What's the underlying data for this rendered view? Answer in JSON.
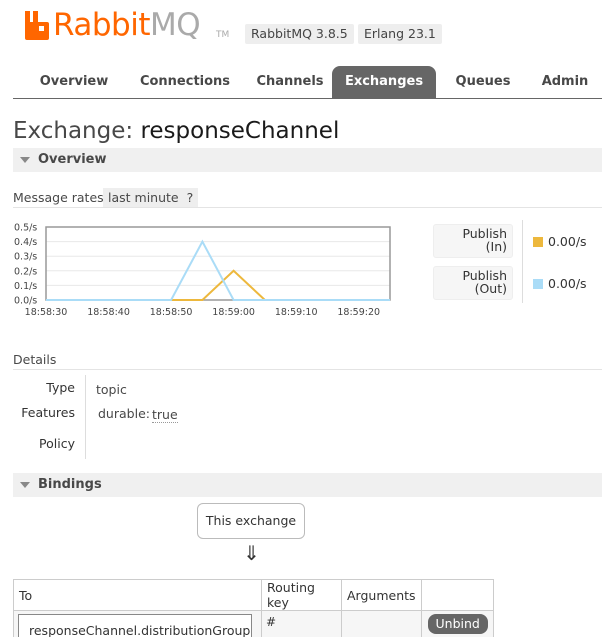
{
  "header": {
    "logo_text_rabbit": "Rabbit",
    "logo_text_mq": "MQ",
    "logo_tm": "TM",
    "logo_icon": "rabbitmq-logo-icon",
    "version_rabbitmq": "RabbitMQ 3.8.5",
    "version_erlang": "Erlang 23.1",
    "brand_color": "#ff6600"
  },
  "tabs": [
    {
      "label": "Overview"
    },
    {
      "label": "Connections"
    },
    {
      "label": "Channels"
    },
    {
      "label": "Exchanges",
      "active": true
    },
    {
      "label": "Queues"
    },
    {
      "label": "Admin"
    }
  ],
  "page": {
    "title_prefix": "Exchange:",
    "exchange_name": "responseChannel"
  },
  "overview": {
    "section_label": "Overview",
    "rates_label": "Message rates",
    "rates_period": "last minute",
    "rates_help": "?",
    "legend": [
      {
        "label_line1": "Publish",
        "label_line2": "(In)",
        "value": "0.00/s",
        "color": "#edb83d"
      },
      {
        "label_line1": "Publish",
        "label_line2": "(Out)",
        "value": "0.00/s",
        "color": "#aadcf7"
      }
    ]
  },
  "chart_data": {
    "type": "line",
    "x": [
      "18:58:30",
      "18:58:35",
      "18:58:40",
      "18:58:45",
      "18:58:50",
      "18:58:55",
      "18:59:00",
      "18:59:05",
      "18:59:10",
      "18:59:15",
      "18:59:20",
      "18:59:25"
    ],
    "x_tick_labels": [
      "18:58:30",
      "18:58:40",
      "18:58:50",
      "18:59:00",
      "18:59:10",
      "18:59:20"
    ],
    "series": [
      {
        "name": "Publish (In)",
        "color": "#edb83d",
        "values": [
          0,
          0,
          0,
          0,
          0,
          0,
          0.2,
          0,
          0,
          0,
          0,
          0
        ]
      },
      {
        "name": "Publish (Out)",
        "color": "#aadcf7",
        "values": [
          0,
          0,
          0,
          0,
          0,
          0.4,
          0,
          0,
          0,
          0,
          0,
          0
        ]
      }
    ],
    "y_tick_labels": [
      "0.5/s",
      "0.4/s",
      "0.3/s",
      "0.2/s",
      "0.1/s",
      "0.0/s"
    ],
    "ylim": [
      0,
      0.5
    ],
    "grid": true,
    "legend_position": "right"
  },
  "details": {
    "heading": "Details",
    "type_label": "Type",
    "type_value": "topic",
    "features_label": "Features",
    "durable_key": "durable:",
    "durable_value": "true",
    "policy_label": "Policy",
    "policy_value": ""
  },
  "bindings": {
    "section_label": "Bindings",
    "this_exchange": "This exchange",
    "arrow": "⇓",
    "columns": [
      "To",
      "Routing key",
      "Arguments",
      ""
    ],
    "rows": [
      {
        "to": "responseChannel.distributionGroup",
        "routing_key": "#",
        "arguments": "",
        "action": "Unbind"
      }
    ]
  }
}
